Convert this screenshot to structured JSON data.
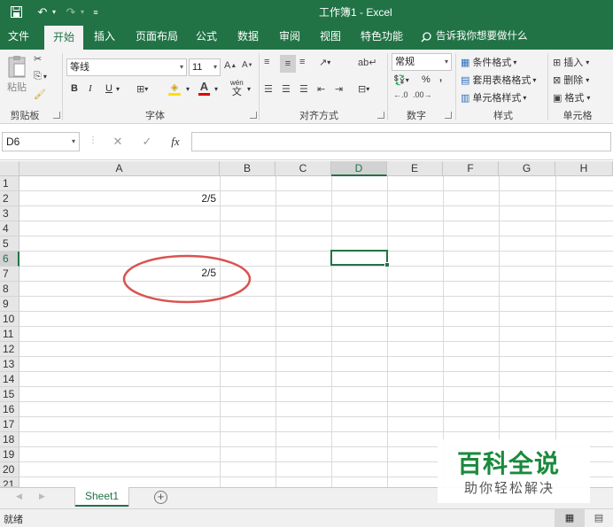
{
  "window": {
    "title": "工作簿1 - Excel"
  },
  "quick_access": {
    "save": "save-icon",
    "undo": "undo-icon",
    "redo": "redo-icon",
    "customize": "customize-icon"
  },
  "tabs": [
    {
      "label": "文件"
    },
    {
      "label": "开始",
      "active": true
    },
    {
      "label": "插入"
    },
    {
      "label": "页面布局"
    },
    {
      "label": "公式"
    },
    {
      "label": "数据"
    },
    {
      "label": "审阅"
    },
    {
      "label": "视图"
    },
    {
      "label": "特色功能"
    }
  ],
  "tell_me": "告诉我你想要做什么",
  "ribbon": {
    "clipboard": {
      "paste": "粘贴",
      "group": "剪贴板"
    },
    "font": {
      "name": "等线",
      "size": "11",
      "bold": "B",
      "italic": "I",
      "underline": "U",
      "phonetic_top": "wén",
      "phonetic_bottom": "文",
      "group": "字体"
    },
    "alignment": {
      "group": "对齐方式"
    },
    "number": {
      "format": "常规",
      "percent": "%",
      "comma": ",",
      "group": "数字"
    },
    "styles": {
      "conditional": "条件格式",
      "table": "套用表格格式",
      "cell_styles": "单元格样式",
      "group": "样式"
    },
    "cells": {
      "insert": "插入",
      "delete": "删除",
      "format": "格式",
      "group": "单元格"
    }
  },
  "formula_bar": {
    "name_box": "D6",
    "cancel": "✕",
    "enter": "✓",
    "fx": "fx",
    "value": ""
  },
  "grid": {
    "columns": [
      "A",
      "B",
      "C",
      "D",
      "E",
      "F",
      "G",
      "H"
    ],
    "rows": [
      "1",
      "2",
      "3",
      "4",
      "5",
      "6",
      "7",
      "8",
      "9",
      "10",
      "11",
      "12",
      "13",
      "14",
      "15",
      "16",
      "17",
      "18",
      "19",
      "20",
      "21"
    ],
    "selected_column": "D",
    "selected_row": "6",
    "cells": {
      "A2": "2/5",
      "A7": "2/5"
    },
    "annotation_color": "#d9534f"
  },
  "sheets": [
    {
      "label": "Sheet1",
      "active": true
    }
  ],
  "status": {
    "text": "就绪"
  },
  "watermark": {
    "title": "百科全说",
    "subtitle": "助你轻松解决"
  },
  "colors": {
    "accent": "#217346"
  }
}
